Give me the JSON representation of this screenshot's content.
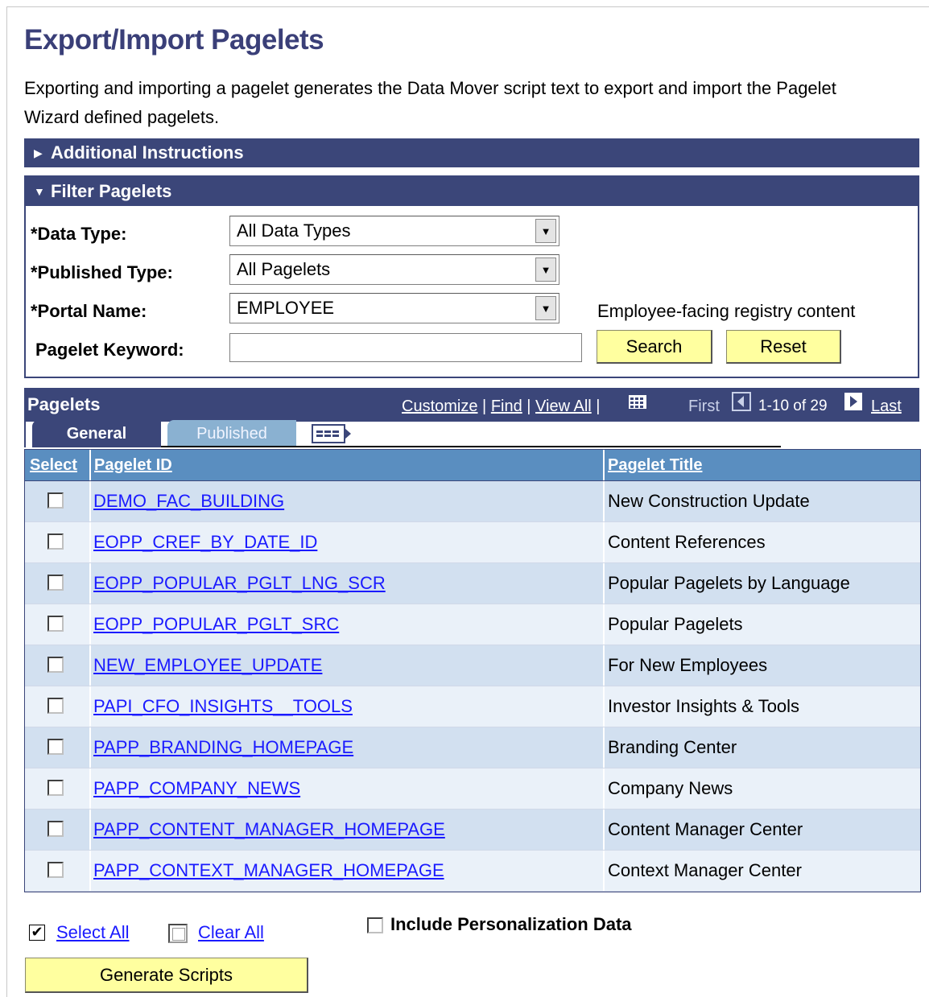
{
  "page": {
    "title": "Export/Import Pagelets",
    "description": "Exporting and importing a pagelet generates the Data Mover script text to export and import the Pagelet Wizard defined pagelets."
  },
  "additional_instructions": {
    "label": "Additional Instructions",
    "expanded": false
  },
  "filter": {
    "label": "Filter Pagelets",
    "data_type": {
      "label": "*Data Type:",
      "value": "All Data Types"
    },
    "published_type": {
      "label": "*Published Type:",
      "value": "All Pagelets"
    },
    "portal_name": {
      "label": "*Portal Name:",
      "value": "EMPLOYEE",
      "description": "Employee-facing registry content"
    },
    "keyword": {
      "label": "Pagelet Keyword:",
      "value": ""
    },
    "search_label": "Search",
    "reset_label": "Reset"
  },
  "grid": {
    "title": "Pagelets",
    "customize": "Customize",
    "find": "Find",
    "view_all": "View All",
    "first": "First",
    "range": "1-10 of 29",
    "last": "Last",
    "tabs": {
      "general": "General",
      "published": "Published"
    },
    "columns": {
      "select": "Select",
      "pagelet_id": "Pagelet ID",
      "pagelet_title": "Pagelet Title"
    },
    "rows": [
      {
        "id": "DEMO_FAC_BUILDING",
        "title": "New Construction Update",
        "checked": false
      },
      {
        "id": "EOPP_CREF_BY_DATE_ID",
        "title": "Content References",
        "checked": false
      },
      {
        "id": "EOPP_POPULAR_PGLT_LNG_SCR",
        "title": "Popular Pagelets by Language",
        "checked": false
      },
      {
        "id": "EOPP_POPULAR_PGLT_SRC",
        "title": "Popular Pagelets",
        "checked": false
      },
      {
        "id": "NEW_EMPLOYEE_UPDATE",
        "title": "For New Employees",
        "checked": false
      },
      {
        "id": "PAPI_CFO_INSIGHTS__TOOLS",
        "title": "Investor Insights & Tools",
        "checked": false
      },
      {
        "id": "PAPP_BRANDING_HOMEPAGE",
        "title": "Branding Center",
        "checked": false
      },
      {
        "id": "PAPP_COMPANY_NEWS",
        "title": "Company News",
        "checked": false
      },
      {
        "id": "PAPP_CONTENT_MANAGER_HOMEPAGE",
        "title": "Content Manager Center",
        "checked": false
      },
      {
        "id": "PAPP_CONTEXT_MANAGER_HOMEPAGE",
        "title": "Context Manager Center",
        "checked": false
      }
    ]
  },
  "actions": {
    "select_all": "Select All",
    "clear_all": "Clear All",
    "include_personalization": "Include Personalization Data",
    "generate_scripts": "Generate Scripts"
  },
  "colors": {
    "header_bar": "#3b4679",
    "column_header": "#5a8ec0",
    "row_odd": "#d2e0f0",
    "row_even": "#eaf1f9",
    "button": "#ffff9f",
    "link": "#1a1aff"
  }
}
